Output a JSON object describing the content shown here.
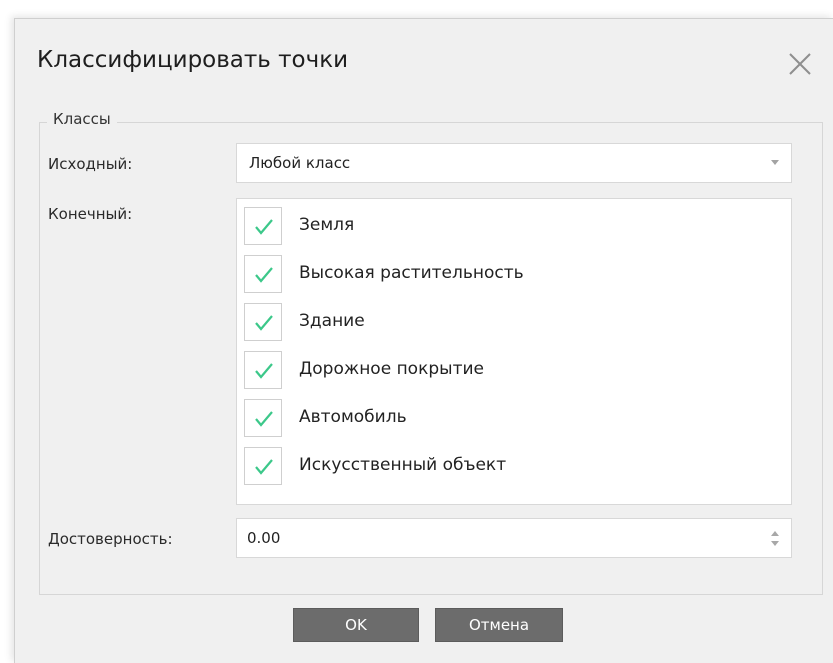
{
  "dialog": {
    "title": "Классифицировать точки"
  },
  "classes": {
    "legend": "Классы",
    "source_label": "Исходный:",
    "source_value": "Любой класс",
    "target_label": "Конечный:",
    "target_items": [
      {
        "label": "Земля",
        "checked": true
      },
      {
        "label": "Высокая растительность",
        "checked": true
      },
      {
        "label": "Здание",
        "checked": true
      },
      {
        "label": "Дорожное покрытие",
        "checked": true
      },
      {
        "label": "Автомобиль",
        "checked": true
      },
      {
        "label": "Искусственный объект",
        "checked": true
      }
    ],
    "confidence_label": "Достоверность:",
    "confidence_value": "0.00"
  },
  "buttons": {
    "ok": "OK",
    "cancel": "Отмена"
  },
  "icons": {
    "close": "close-icon",
    "check": "check-icon",
    "dropdown": "chevron-down-icon",
    "spin_up": "spin-up-icon",
    "spin_down": "spin-down-icon"
  },
  "colors": {
    "check": "#3cc88a",
    "button_bg": "#6c6c6c",
    "dialog_bg": "#f0f0f0"
  }
}
